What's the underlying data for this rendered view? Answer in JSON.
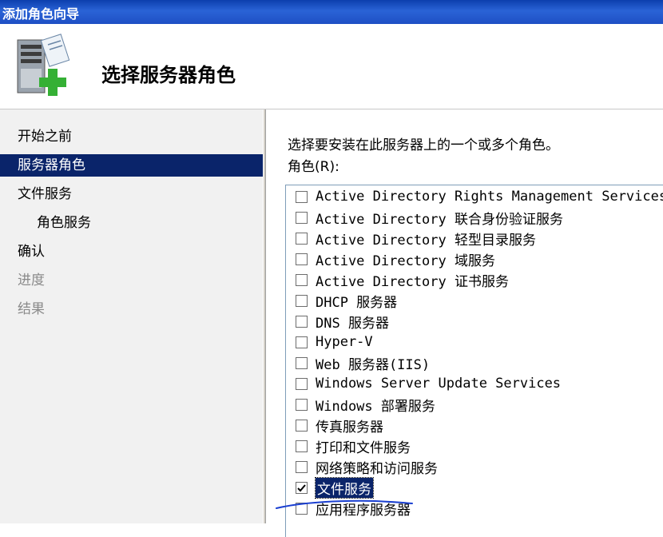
{
  "window": {
    "title": "添加角色向导"
  },
  "header": {
    "title": "选择服务器角色",
    "icon": "server-add-icon"
  },
  "nav": {
    "items": [
      {
        "label": "开始之前",
        "state": "normal"
      },
      {
        "label": "服务器角色",
        "state": "selected"
      },
      {
        "label": "文件服务",
        "state": "normal"
      },
      {
        "label": "角色服务",
        "state": "normal"
      },
      {
        "label": "确认",
        "state": "normal"
      },
      {
        "label": "进度",
        "state": "disabled"
      },
      {
        "label": "结果",
        "state": "disabled"
      }
    ]
  },
  "main": {
    "instruction": "选择要安装在此服务器上的一个或多个角色。",
    "roles_label": "角色(R):",
    "roles": [
      {
        "label": "Active Directory Rights Management Services",
        "checked": false
      },
      {
        "label": "Active Directory 联合身份验证服务",
        "checked": false
      },
      {
        "label": "Active Directory 轻型目录服务",
        "checked": false
      },
      {
        "label": "Active Directory 域服务",
        "checked": false
      },
      {
        "label": "Active Directory 证书服务",
        "checked": false
      },
      {
        "label": "DHCP 服务器",
        "checked": false
      },
      {
        "label": "DNS 服务器",
        "checked": false
      },
      {
        "label": "Hyper-V",
        "checked": false
      },
      {
        "label": "Web 服务器(IIS)",
        "checked": false
      },
      {
        "label": "Windows Server Update Services",
        "checked": false
      },
      {
        "label": "Windows 部署服务",
        "checked": false
      },
      {
        "label": "传真服务器",
        "checked": false
      },
      {
        "label": "打印和文件服务",
        "checked": false
      },
      {
        "label": "网络策略和访问服务",
        "checked": false
      },
      {
        "label": "文件服务",
        "checked": true,
        "focused": true
      },
      {
        "label": "应用程序服务器",
        "checked": false
      }
    ]
  },
  "colors": {
    "selection": "#0a246a",
    "titlebar": "#2a63d6",
    "annotation": "#1a3fd1"
  }
}
